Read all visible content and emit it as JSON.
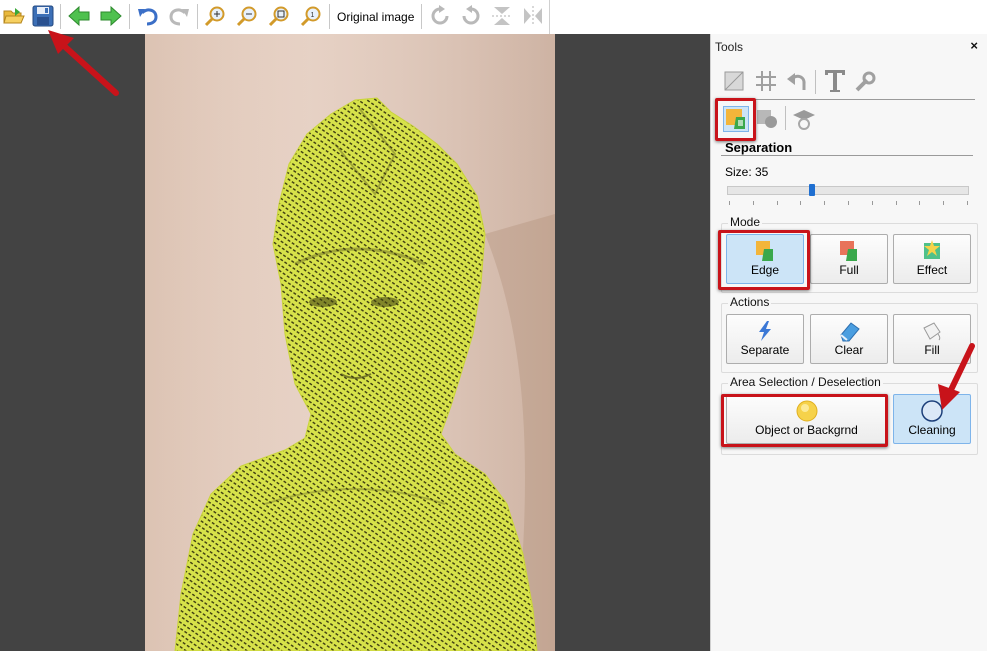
{
  "toolbar": {
    "buttons": [
      {
        "name": "open-folder-icon"
      },
      {
        "name": "save-icon"
      },
      {
        "name": "back-arrow-icon"
      },
      {
        "name": "forward-arrow-icon"
      },
      {
        "name": "undo-icon"
      },
      {
        "name": "redo-icon"
      },
      {
        "name": "zoom-in-icon"
      },
      {
        "name": "zoom-out-icon"
      },
      {
        "name": "zoom-fit-icon"
      },
      {
        "name": "zoom-actual-icon"
      },
      {
        "name": "rotate-cw-icon"
      },
      {
        "name": "rotate-ccw-icon"
      },
      {
        "name": "flip-vertical-icon"
      },
      {
        "name": "flip-horizontal-icon"
      }
    ],
    "original_image_label": "Original image"
  },
  "panel": {
    "title": "Tools",
    "close_glyph": "×",
    "section_title": "Separation",
    "size_label": "Size: 35",
    "size_value": 35,
    "mode": {
      "label": "Mode",
      "buttons": [
        {
          "label": "Edge",
          "active": true
        },
        {
          "label": "Full",
          "active": false
        },
        {
          "label": "Effect",
          "active": false
        }
      ]
    },
    "actions": {
      "label": "Actions",
      "buttons": [
        {
          "label": "Separate"
        },
        {
          "label": "Clear"
        },
        {
          "label": "Fill"
        }
      ]
    },
    "area": {
      "label": "Area Selection / Deselection",
      "buttons": [
        {
          "label": "Object or Backgrnd",
          "active": false
        },
        {
          "label": "Cleaning",
          "active": true
        }
      ]
    }
  },
  "colors": {
    "highlight": "#c8131a",
    "selection_overlay": "#d7e24a",
    "active_button": "#cce4f7",
    "canvas_bg": "#434343"
  }
}
